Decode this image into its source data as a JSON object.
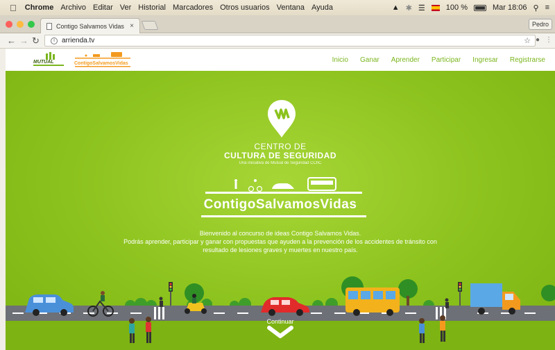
{
  "menubar": {
    "app": "Chrome",
    "menus": [
      "Archivo",
      "Editar",
      "Ver",
      "Historial",
      "Marcadores",
      "Otros usuarios",
      "Ventana",
      "Ayuda"
    ],
    "battery": "100 %",
    "clock": "Mar 18:06"
  },
  "browser": {
    "tab_title": "Contigo Salvamos Vidas",
    "tab_close": "×",
    "user": "Pedro",
    "url": "arrienda.tv"
  },
  "site": {
    "nav": [
      "Inicio",
      "Ganar",
      "Aprender",
      "Participar",
      "Ingresar",
      "Registrarse"
    ],
    "hero": {
      "line1": "CENTRO DE",
      "line2": "CULTURA DE SEGURIDAD",
      "line3": "Una iniciativa de Mutual de Seguridad CChC",
      "brand": "ContigoSalvamosVidas",
      "welcome_1": "Bienvenido al concurso de ideas Contigo Salvamos Vidas.",
      "welcome_2": "Podrás aprender, participar y ganar con propuestas que ayuden a la prevención de los accidentes de tránsito con",
      "welcome_3": "resultado de lesiones graves y muertes en nuestro país.",
      "continue": "Continuar"
    }
  },
  "colors": {
    "accent_green": "#7ab51d",
    "hero_green": "#8cc21d",
    "orange": "#f39a1e"
  },
  "icons": [
    "apple-icon",
    "wifi-icon",
    "bluetooth-icon",
    "search-icon",
    "list-icon",
    "back-icon",
    "forward-icon",
    "reload-icon",
    "info-icon",
    "star-icon",
    "location-pin-icon",
    "chevron-down-icon"
  ]
}
